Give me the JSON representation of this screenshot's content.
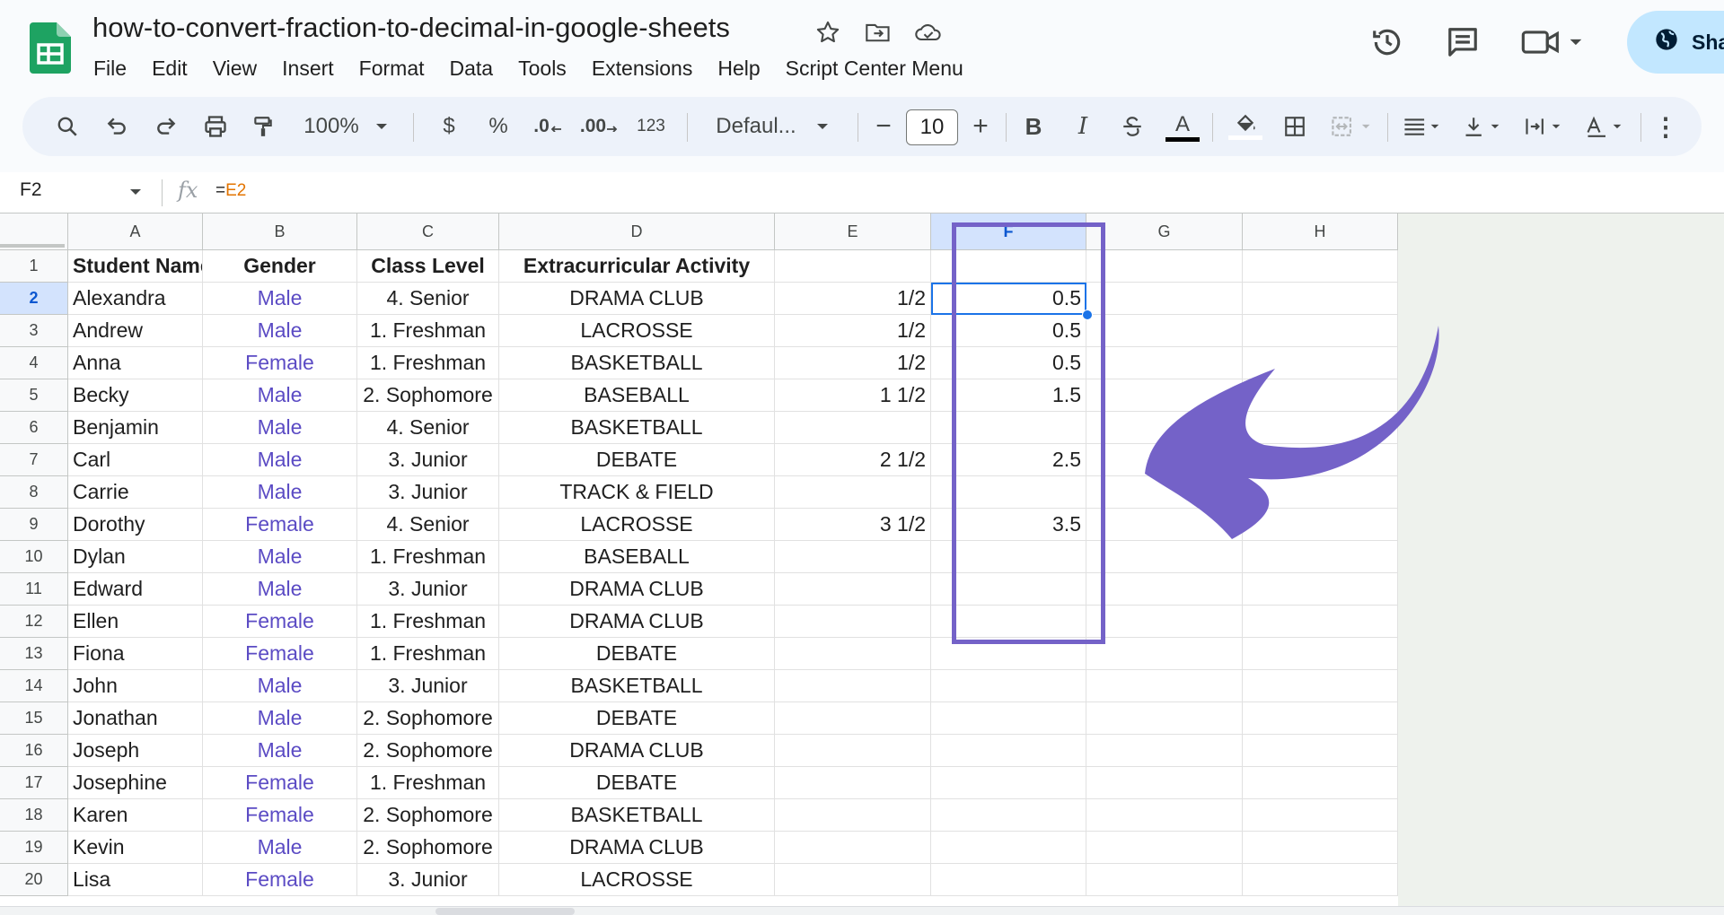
{
  "app": {
    "doc_title": "how-to-convert-fraction-to-decimal-in-google-sheets",
    "menu": [
      "File",
      "Edit",
      "View",
      "Insert",
      "Format",
      "Data",
      "Tools",
      "Extensions",
      "Help",
      "Script Center Menu"
    ],
    "share_label": "Sha"
  },
  "toolbar": {
    "zoom": "100%",
    "currency": "$",
    "percent": "%",
    "dec_decrease": ".0",
    "dec_increase": ".00",
    "number_format": "123",
    "font": "Defaul...",
    "font_size": "10",
    "minus": "−",
    "plus": "+",
    "bold": "B",
    "italic": "I",
    "text_color_letter": "A",
    "more": "⋮"
  },
  "formula_bar": {
    "name_box": "F2",
    "fx": "fx",
    "formula_prefix": "=",
    "formula_ref": "E2"
  },
  "sheet": {
    "columns": [
      "A",
      "B",
      "C",
      "D",
      "E",
      "F",
      "G",
      "H"
    ],
    "active_column": "F",
    "active_row": 2,
    "header_row": [
      "Student Name",
      "Gender",
      "Class Level",
      "Extracurricular Activity",
      "",
      "",
      "",
      ""
    ],
    "rows": [
      [
        "Alexandra",
        "Male",
        "4. Senior",
        "DRAMA CLUB",
        "1/2",
        "0.5"
      ],
      [
        "Andrew",
        "Male",
        "1. Freshman",
        "LACROSSE",
        "1/2",
        "0.5"
      ],
      [
        "Anna",
        "Female",
        "1. Freshman",
        "BASKETBALL",
        "1/2",
        "0.5"
      ],
      [
        "Becky",
        "Male",
        "2. Sophomore",
        "BASEBALL",
        "1 1/2",
        "1.5"
      ],
      [
        "Benjamin",
        "Male",
        "4. Senior",
        "BASKETBALL",
        "",
        ""
      ],
      [
        "Carl",
        "Male",
        "3. Junior",
        "DEBATE",
        "2 1/2",
        "2.5"
      ],
      [
        "Carrie",
        "Male",
        "3. Junior",
        "TRACK & FIELD",
        "",
        ""
      ],
      [
        "Dorothy",
        "Female",
        "4. Senior",
        "LACROSSE",
        "3 1/2",
        "3.5"
      ],
      [
        "Dylan",
        "Male",
        "1. Freshman",
        "BASEBALL",
        "",
        ""
      ],
      [
        "Edward",
        "Male",
        "3. Junior",
        "DRAMA CLUB",
        "",
        ""
      ],
      [
        "Ellen",
        "Female",
        "1. Freshman",
        "DRAMA CLUB",
        "",
        ""
      ],
      [
        "Fiona",
        "Female",
        "1. Freshman",
        "DEBATE",
        "",
        ""
      ],
      [
        "John",
        "Male",
        "3. Junior",
        "BASKETBALL",
        "",
        ""
      ],
      [
        "Jonathan",
        "Male",
        "2. Sophomore",
        "DEBATE",
        "",
        ""
      ],
      [
        "Joseph",
        "Male",
        "2. Sophomore",
        "DRAMA CLUB",
        "",
        ""
      ],
      [
        "Josephine",
        "Female",
        "1. Freshman",
        "DEBATE",
        "",
        ""
      ],
      [
        "Karen",
        "Female",
        "2. Sophomore",
        "BASKETBALL",
        "",
        ""
      ],
      [
        "Kevin",
        "Male",
        "2. Sophomore",
        "DRAMA CLUB",
        "",
        ""
      ],
      [
        "Lisa",
        "Female",
        "3. Junior",
        "LACROSSE",
        "",
        ""
      ]
    ]
  },
  "colors": {
    "accent_purple": "#7462c8",
    "gender_purple": "#5b4bc4",
    "selection_blue": "#1a73e8",
    "sheets_green": "#1ea362"
  },
  "icons": [
    "sheets-logo-icon",
    "star-icon",
    "move-folder-icon",
    "cloud-status-icon",
    "history-icon",
    "comment-icon",
    "video-icon",
    "globe-icon",
    "search-icon",
    "undo-icon",
    "redo-icon",
    "print-icon",
    "paint-format-icon",
    "strikethrough-icon",
    "fill-color-icon",
    "borders-icon",
    "merge-icon",
    "align-icon",
    "valign-icon",
    "text-wrap-icon",
    "text-rotation-icon",
    "more-icon",
    "arrow-annotation-icon"
  ]
}
